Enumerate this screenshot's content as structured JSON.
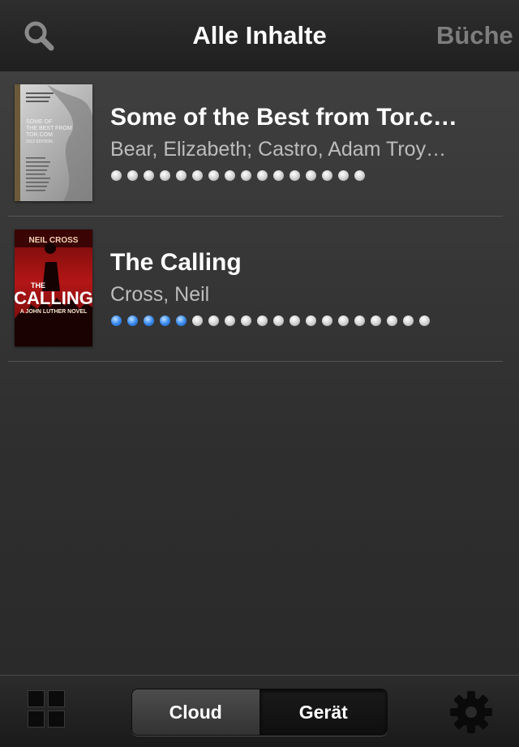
{
  "header": {
    "title": "Alle Inhalte",
    "next_tab": "Büche",
    "search_icon": "search-icon"
  },
  "books": [
    {
      "title": "Some of the Best from Tor.c…",
      "author": "Bear, Elizabeth; Castro, Adam Troy…",
      "progress_total": 16,
      "progress_read": 0,
      "cover": {
        "lines": [
          "SOME OF",
          "THE BEST FROM",
          "TOR.COM",
          "2012 EDITION"
        ]
      }
    },
    {
      "title": "The Calling",
      "author": "Cross, Neil",
      "progress_total": 20,
      "progress_read": 5,
      "cover": {
        "author": "NEIL CROSS",
        "title1": "THE",
        "title2": "CALLING",
        "subtitle": "A JOHN LUTHER NOVEL"
      }
    }
  ],
  "footer": {
    "cloud_label": "Cloud",
    "device_label": "Gerät",
    "grid_icon": "grid-view-icon",
    "settings_icon": "gear-icon"
  },
  "colors": {
    "progress_read": "#3b8cf0",
    "progress_unread": "#e6e6e6",
    "background": "#363636"
  }
}
